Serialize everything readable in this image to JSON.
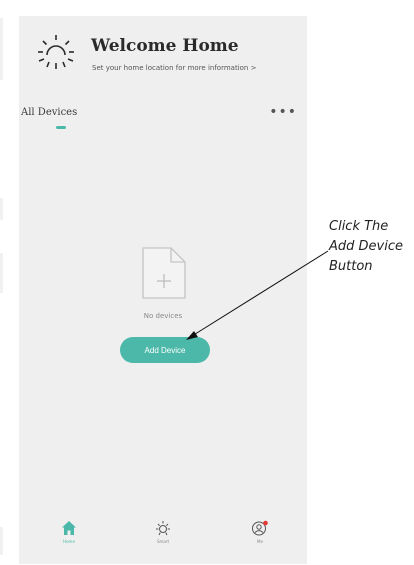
{
  "header": {
    "title": "Welcome Home",
    "subtitle": "Set your home location for more information >",
    "icon": "sun-icon"
  },
  "tabs": {
    "active_label": "All Devices",
    "menu_label": "•••"
  },
  "empty_state": {
    "icon": "empty-file-add-icon",
    "message": "No devices",
    "button_label": "Add Device"
  },
  "bottom_nav": {
    "items": [
      {
        "label": "Home",
        "icon": "home-icon",
        "active": true
      },
      {
        "label": "Smart",
        "icon": "sun-icon",
        "active": false
      },
      {
        "label": "Me",
        "icon": "user-icon",
        "active": false
      }
    ]
  },
  "annotation": {
    "line1": "Click The",
    "line2": "Add Device",
    "line3": "Button"
  },
  "colors": {
    "accent": "#4bb8a9",
    "background": "#efefef",
    "notification_dot": "#e53935"
  }
}
